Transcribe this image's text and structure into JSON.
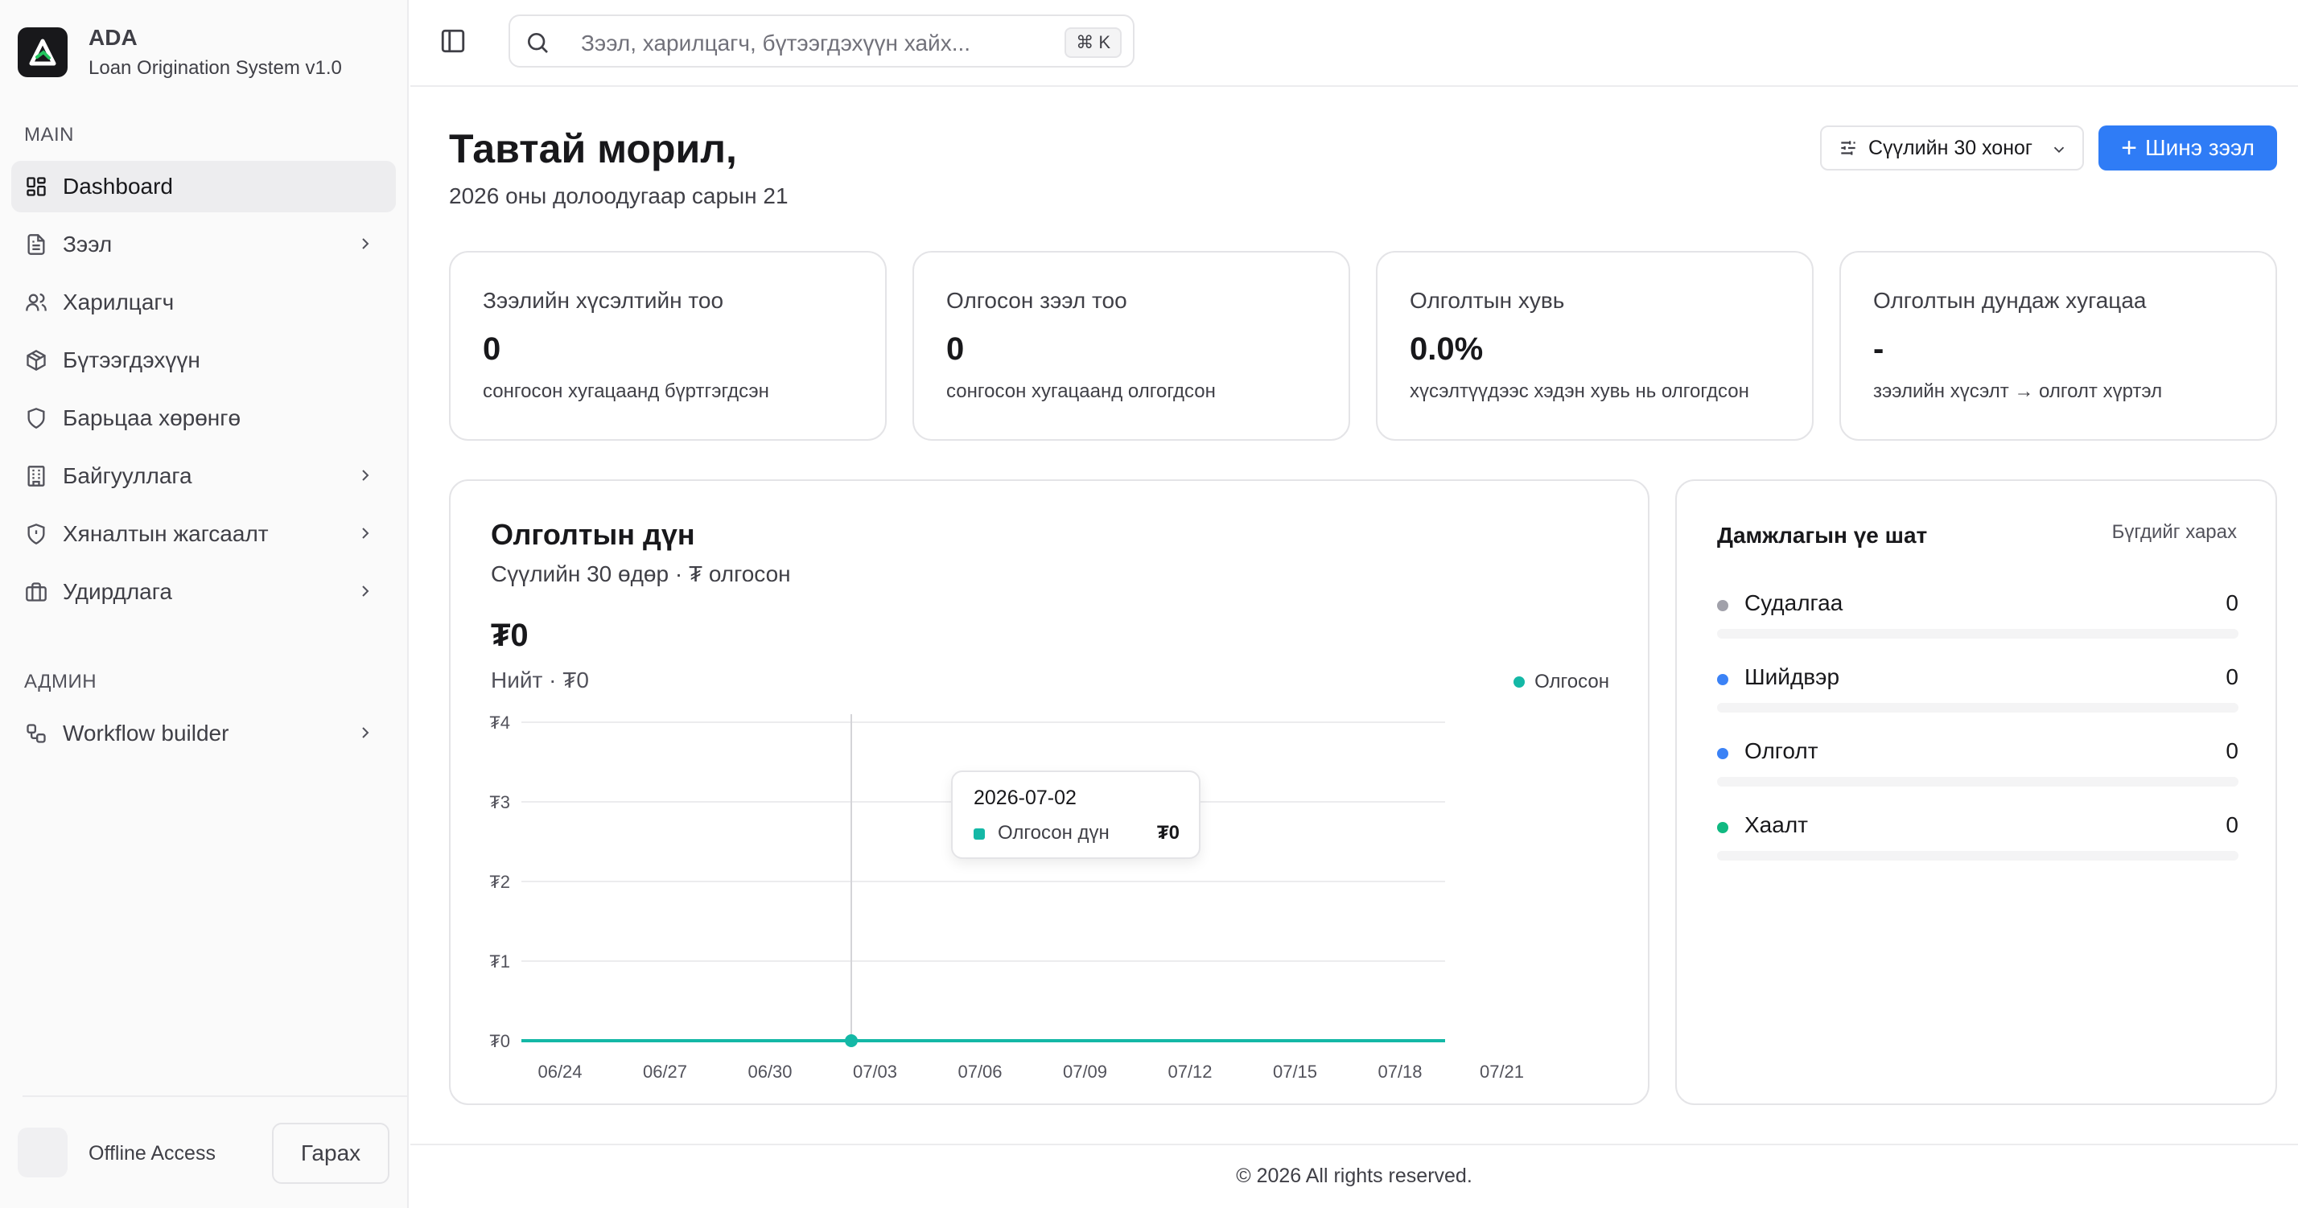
{
  "brand": {
    "name": "ADA",
    "subtitle": "Loan Origination System v1.0"
  },
  "sidebar": {
    "main_label": "MAIN",
    "admin_label": "АДМИН",
    "items": [
      {
        "label": "Dashboard",
        "icon": "dashboard-icon",
        "active": true,
        "chevron": false
      },
      {
        "label": "Зээл",
        "icon": "document-icon",
        "chevron": true
      },
      {
        "label": "Харилцагч",
        "icon": "users-icon",
        "chevron": false
      },
      {
        "label": "Бүтээгдэхүүн",
        "icon": "package-icon",
        "chevron": false
      },
      {
        "label": "Барьцаа хөрөнгө",
        "icon": "shield-icon",
        "chevron": false
      },
      {
        "label": "Байгууллага",
        "icon": "building-icon",
        "chevron": true
      },
      {
        "label": "Хяналтын жагсаалт",
        "icon": "shield-alert-icon",
        "chevron": true
      },
      {
        "label": "Удирдлага",
        "icon": "briefcase-icon",
        "chevron": true
      }
    ],
    "admin_items": [
      {
        "label": "Workflow builder",
        "icon": "workflow-icon",
        "chevron": true
      }
    ],
    "offline_label": "Offline Access",
    "logout_label": "Гарах"
  },
  "topbar": {
    "search_placeholder": "Зээл, харилцагч, бүтээгдэхүүн хайх...",
    "shortcut": "⌘ K"
  },
  "header": {
    "title": "Тавтай морил,",
    "date": "2026 оны долоодугаар сарын 21",
    "period_label": "Сүүлийн 30 хоног",
    "new_button_label": "Шинэ зээл"
  },
  "kpis": [
    {
      "title": "Зээлийн хүсэлтийн тоо",
      "value": "0",
      "note": "сонгосон хугацаанд бүртгэгдсэн"
    },
    {
      "title": "Олгосон зээл тоо",
      "value": "0",
      "note": "сонгосон хугацаанд олгогдсон"
    },
    {
      "title": "Олголтын хувь",
      "value": "0.0%",
      "note": "хүсэлтүүдээс хэдэн хувь нь олгогдсон"
    },
    {
      "title": "Олголтын дундаж хугацаа",
      "value": "-",
      "note": "зээлийн хүсэлт → олголт хүртэл"
    }
  ],
  "chart_card": {
    "title": "Олголтын дүн",
    "subtitle": "Сүүлийн 30 өдөр · ₮ олгосон",
    "total_value": "₮0",
    "total_label": "Нийт · ₮0",
    "legend_label": "Олгосон",
    "tooltip": {
      "date": "2026-07-02",
      "label": "Олгосон дүн",
      "value": "₮0"
    }
  },
  "chart_data": {
    "type": "line",
    "x_ticks": [
      "06/24",
      "06/27",
      "06/30",
      "07/03",
      "07/06",
      "07/09",
      "07/12",
      "07/15",
      "07/18",
      "07/21"
    ],
    "y_ticks": [
      "₮4",
      "₮3",
      "₮2",
      "₮1",
      "₮0"
    ],
    "ylim": [
      0,
      4
    ],
    "series": [
      {
        "name": "Олгосон",
        "color": "#14b8a6",
        "x_start": "06/21",
        "x_end": "07/21",
        "values": [
          0,
          0
        ]
      }
    ],
    "highlight": {
      "x": "07/02",
      "value": 0
    },
    "grid": true,
    "legend_position": "top-right"
  },
  "pipeline": {
    "title": "Дамжлагын үе шат",
    "view_all": "Бүгдийг харах",
    "stages": [
      {
        "name": "Судалгаа",
        "count": "0",
        "color": "#a1a1aa",
        "fraction": 0
      },
      {
        "name": "Шийдвэр",
        "count": "0",
        "color": "#3b82f6",
        "fraction": 0
      },
      {
        "name": "Олголт",
        "count": "0",
        "color": "#3b82f6",
        "fraction": 0
      },
      {
        "name": "Хаалт",
        "count": "0",
        "color": "#10b981",
        "fraction": 0
      }
    ]
  },
  "footer": {
    "text": "© 2026 All rights reserved."
  }
}
